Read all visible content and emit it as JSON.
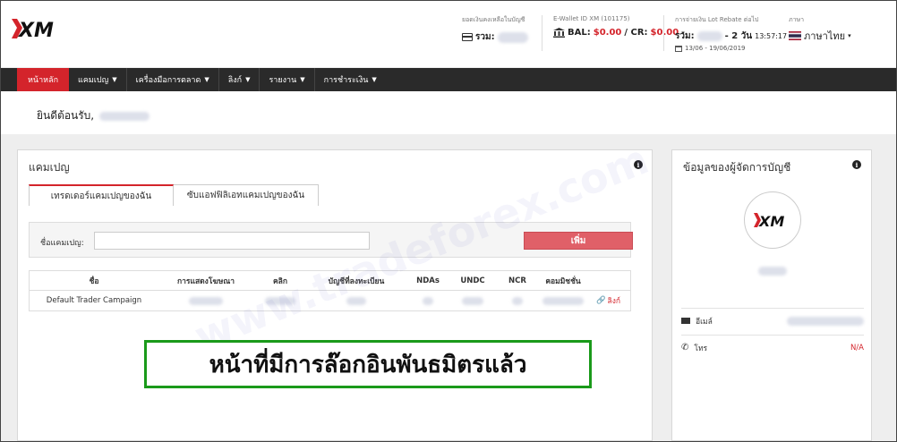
{
  "header": {
    "balance_caption": "ยอดเงินคงเหลือในบัญชี",
    "balance_label": "รวม:",
    "ewallet_caption": "E-Wallet ID XM (101175)",
    "ewallet_bal_label": "BAL:",
    "ewallet_bal_value": "$0.00",
    "ewallet_cr_label": "/ CR:",
    "ewallet_cr_value": "$0.00",
    "rebate_caption": "การจ่ายเงิน Lot Rebate ต่อไป",
    "rebate_label": "รวม:",
    "rebate_countdown": "- 2 วัน",
    "rebate_time": "13:57:17",
    "rebate_range": "13/06 - 19/06/2019",
    "language_caption": "ภาษา",
    "language_value": "ภาษาไทย"
  },
  "nav": {
    "items": [
      {
        "label": "หน้าหลัก",
        "active": true,
        "dropdown": false
      },
      {
        "label": "แคมเปญ",
        "dropdown": true
      },
      {
        "label": "เครื่องมือการตลาด",
        "dropdown": true
      },
      {
        "label": "ลิงก์",
        "dropdown": true
      },
      {
        "label": "รายงาน",
        "dropdown": true
      },
      {
        "label": "การชำระเงิน",
        "dropdown": true
      }
    ]
  },
  "welcome": {
    "text": "ยินดีต้อนรับ,"
  },
  "campaign_panel": {
    "title": "แคมเปญ",
    "tabs": [
      "เทรดเดอร์แคมเปญของฉัน",
      "ซับแอฟฟิลิเอทแคมเปญของฉัน"
    ],
    "filter_label": "ชื่อแคมเปญ:",
    "filter_value": "",
    "add_button": "เพิ่ม",
    "columns": [
      "ชื่อ",
      "การแสดงโฆษณา",
      "คลิก",
      "บัญชีที่ลงทะเบียน",
      "NDAs",
      "UNDC",
      "NCR",
      "คอมมิชชั่น",
      ""
    ],
    "rows": [
      {
        "name": "Default Trader Campaign",
        "link_label": "ลิงก์"
      }
    ]
  },
  "manager_panel": {
    "title": "ข้อมูลของผู้จัดการบัญชี",
    "email_label": "อีเมล์",
    "phone_label": "โทร",
    "phone_value": "N/A"
  },
  "overlay": {
    "banner_text": "หน้าที่มีการล๊อกอินพันธมิตรแล้ว"
  },
  "watermark": "www.tradeforex.com",
  "colors": {
    "accent": "#d4242b",
    "nav_bg": "#2a2a2a",
    "banner_border": "#1a9a1a"
  }
}
